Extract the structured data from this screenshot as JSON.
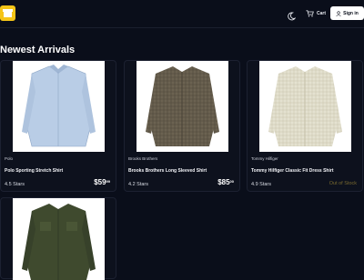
{
  "header": {
    "cart_label": "Cart",
    "signin_label": "Sign in"
  },
  "page": {
    "heading": "Newest Arrivals"
  },
  "products": [
    {
      "brand": "Polo",
      "name": "Polo Sporting Stretch Shirt",
      "rating": "4.5 Stars",
      "price_main": "$59",
      "price_cents": "99",
      "shirt_color": "#b9cde6"
    },
    {
      "brand": "Brooks Brothers",
      "name": "Brooks Brothers Long Sleeved Shirt",
      "rating": "4.2 Stars",
      "price_main": "$85",
      "price_cents": "00",
      "shirt_color": "#6b6251"
    },
    {
      "brand": "Tommy Hilfiger",
      "name": "Tommy Hilfiger Classic Fit Dress Shirt",
      "rating": "4.9 Stars",
      "stock_status": "Out of Stock",
      "shirt_color": "#e4e1d0"
    },
    {
      "shirt_color": "#3f4a2e"
    }
  ],
  "colors": {
    "background": "#0a0e1a",
    "logo": "#f5c518",
    "out_of_stock": "#7a6a2f"
  }
}
